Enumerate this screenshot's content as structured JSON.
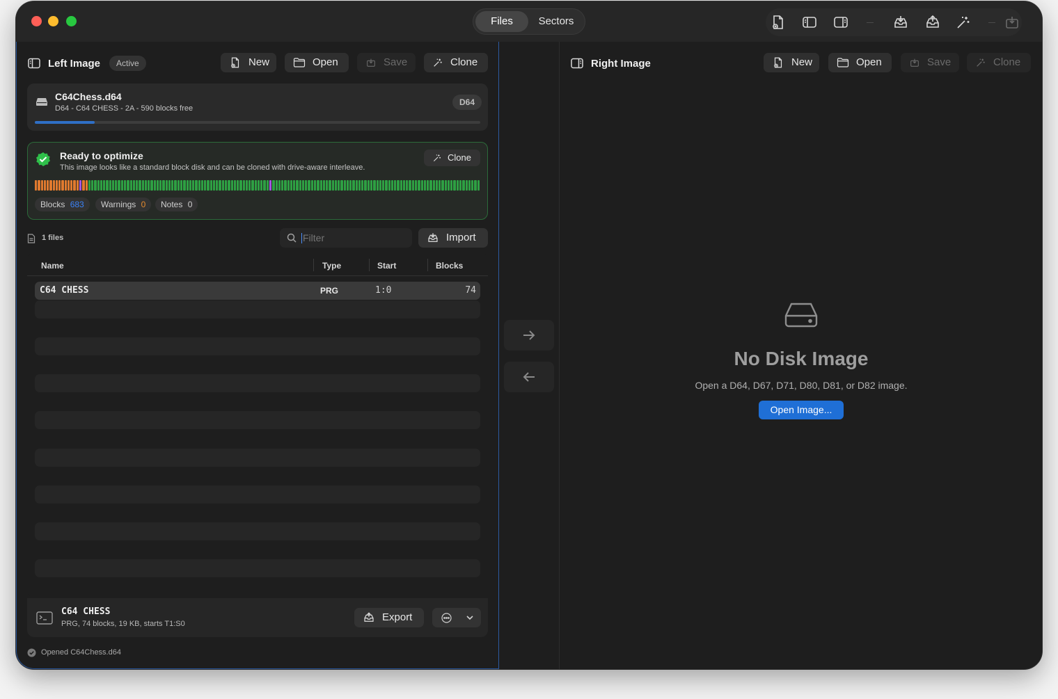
{
  "toolbar": {
    "segments": [
      "Files",
      "Sectors"
    ],
    "selected_segment": "Files",
    "icons": [
      "new-disk-icon",
      "left-panel-icon",
      "right-panel-icon",
      "import-icon",
      "export-icon",
      "clone-icon",
      "save-icon"
    ]
  },
  "left": {
    "title": "Left Image",
    "badge": "Active",
    "buttons": {
      "new": "New",
      "open": "Open",
      "save": "Save",
      "clone": "Clone"
    },
    "disk": {
      "filename": "C64Chess.d64",
      "info": "D64 - C64 CHESS - 2A - 590 blocks free",
      "format_badge": "D64",
      "usage_fraction": 0.135
    },
    "optimize": {
      "title": "Ready to optimize",
      "desc": "This image looks like a standard block disk and can be cloned with drive-aware interleave.",
      "clone_label": "Clone",
      "blocks_label": "Blocks",
      "blocks_value": "683",
      "warnings_label": "Warnings",
      "warnings_value": "0",
      "notes_label": "Notes",
      "notes_value": "0"
    },
    "files": {
      "count_label": "1 files",
      "filter_placeholder": "Filter",
      "import_label": "Import",
      "columns": {
        "name": "Name",
        "type": "Type",
        "start": "Start",
        "blocks": "Blocks"
      },
      "rows": [
        {
          "name": "C64 CHESS",
          "type": "PRG",
          "start": "1:0",
          "blocks": "74"
        }
      ]
    },
    "selection": {
      "name": "C64 CHESS",
      "detail": "PRG, 74 blocks, 19 KB, starts T1:S0",
      "export_label": "Export"
    },
    "status": "Opened C64Chess.d64"
  },
  "right": {
    "title": "Right Image",
    "buttons": {
      "new": "New",
      "open": "Open",
      "save": "Save",
      "clone": "Clone"
    },
    "empty": {
      "title": "No Disk Image",
      "desc": "Open a D64, D67, D71, D80, D81, or D82 image.",
      "button": "Open Image..."
    }
  },
  "colors": {
    "accent": "#1f6fd6",
    "ok_green": "#2fbf4a",
    "bar_green": "#2ea043",
    "bar_orange": "#e07a2f",
    "bar_purple": "#a455e0",
    "blocks_blue": "#3b82f6",
    "warn_orange": "#e58a2d"
  }
}
